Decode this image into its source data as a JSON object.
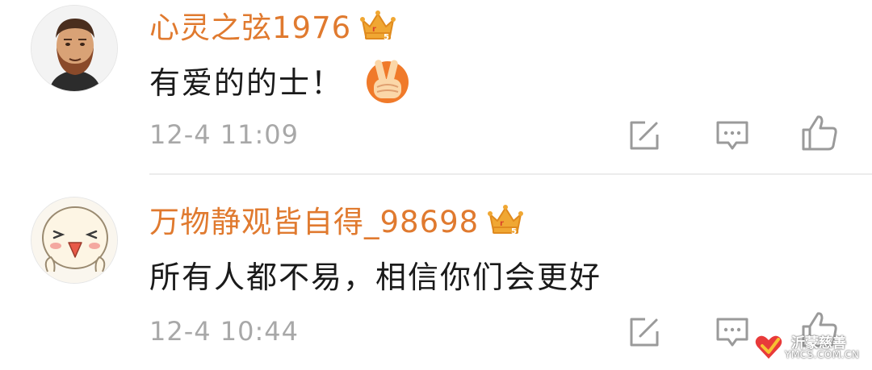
{
  "comments": [
    {
      "username": "心灵之弦1976",
      "text": "有爱的的士！",
      "timestamp": "12-4 11:09",
      "avatar_icon": "bearded-man-avatar",
      "badge_icon": "vip-crown-icon",
      "emoji_icon": "victory-hand-emoji"
    },
    {
      "username": "万物静观皆自得_98698",
      "text": "所有人都不易，相信你们会更好",
      "timestamp": "12-4 10:44",
      "avatar_icon": "cartoon-face-avatar",
      "badge_icon": "vip-crown-icon"
    }
  ],
  "actions": [
    "repost-icon",
    "reply-icon",
    "like-icon"
  ],
  "colors": {
    "username": "#e07a2f",
    "timestamp": "#a8a8a8",
    "text": "#1a1a1a",
    "icon": "#9a9a9a",
    "crown": "#f0a733"
  },
  "watermark": {
    "title": "沂蒙慈善",
    "url": "YMCS.COM.CN"
  }
}
